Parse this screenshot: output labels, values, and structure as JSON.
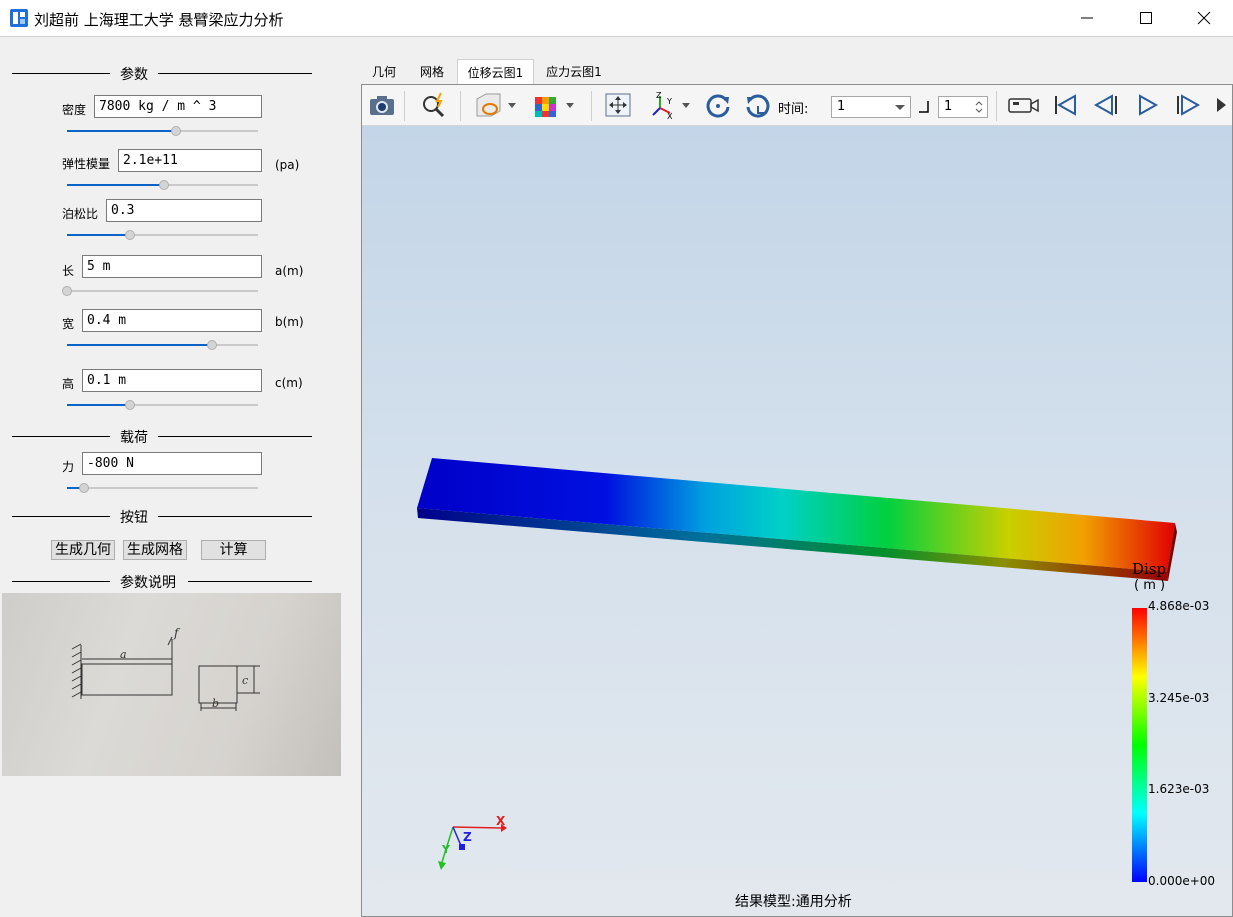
{
  "window": {
    "title": "刘超前 上海理工大学 悬臂梁应力分析",
    "minimize_icon": "minimize-icon",
    "maximize_icon": "maximize-icon",
    "close_icon": "close-icon"
  },
  "sections": {
    "params": "参数",
    "load": "载荷",
    "buttons": "按钮",
    "explain": "参数说明"
  },
  "params": [
    {
      "label": "密度",
      "value": "7800 kg / m ^ 3",
      "unit": "",
      "slider": 0.57
    },
    {
      "label": "弹性模量",
      "value": "2.1e+11",
      "unit": "(pa)",
      "slider": 0.51
    },
    {
      "label": "泊松比",
      "value": "0.3",
      "unit": "",
      "slider": 0.33
    },
    {
      "label": "长",
      "value": "5 m",
      "unit": "a(m)",
      "slider": 0.0
    },
    {
      "label": "宽",
      "value": "0.4 m",
      "unit": "b(m)",
      "slider": 0.76
    },
    {
      "label": "高",
      "value": "0.1 m",
      "unit": "c(m)",
      "slider": 0.33
    }
  ],
  "load": {
    "label": "力",
    "value": "-800 N",
    "slider": 0.09
  },
  "buttons": {
    "gen_geometry": "生成几何",
    "gen_mesh": "生成网格",
    "compute": "计算"
  },
  "sketch": {
    "label_a": "a",
    "label_b": "b",
    "label_c": "c",
    "label_f": "f"
  },
  "tabs": [
    {
      "label": "几何",
      "active": false
    },
    {
      "label": "网格",
      "active": false
    },
    {
      "label": "位移云图1",
      "active": true
    },
    {
      "label": "应力云图1",
      "active": false
    }
  ],
  "toolbar": {
    "time_label": "时间:",
    "time_value": "1",
    "step_value": "1",
    "icons": [
      "camera-icon",
      "query-icon",
      "clip-plane-icon",
      "display-style-icon",
      "fit-view-icon",
      "axes-view-icon",
      "rotate-cw-icon",
      "rotate-ccw-icon",
      "record-icon",
      "first-frame-icon",
      "prev-frame-icon",
      "play-icon",
      "next-frame-icon",
      "last-frame-icon"
    ]
  },
  "legend": {
    "title": "Disp",
    "unit": "( m )",
    "ticks": [
      "4.868e-03",
      "3.245e-03",
      "1.623e-03",
      "0.000e+00"
    ],
    "colors": [
      "#ff0000",
      "#ffff00",
      "#00ff00",
      "#00ffff",
      "#0000ff"
    ]
  },
  "axes": {
    "x": "X",
    "y": "Y",
    "z": "Z"
  },
  "status": "结果模型:通用分析"
}
